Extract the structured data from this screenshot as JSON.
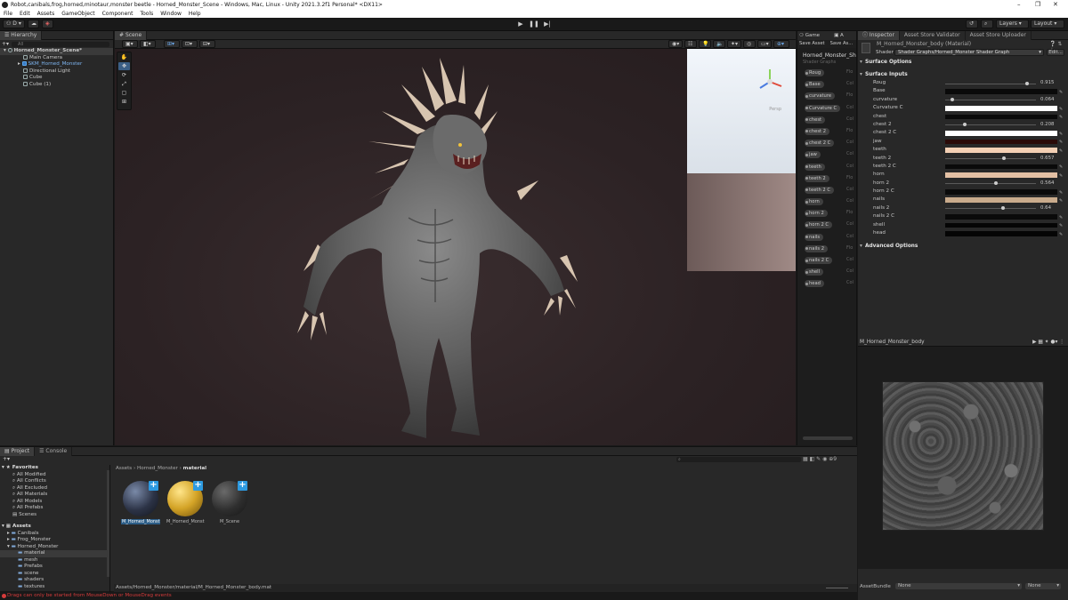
{
  "window": {
    "title": "Robot,canibals,frog,horned,minotaur,monster beetle - Horned_Monster_Scene - Windows, Mac, Linux - Unity 2021.3.2f1 Personal* <DX11>"
  },
  "menu": [
    "File",
    "Edit",
    "Assets",
    "GameObject",
    "Component",
    "Tools",
    "Window",
    "Help"
  ],
  "toolbar": {
    "account": "D",
    "layers": "Layers",
    "layout": "Layout"
  },
  "hierarchy": {
    "tab": "Hierarchy",
    "search_placeholder": "All",
    "scene": "Horned_Monster_Scene*",
    "items": [
      {
        "label": "Main Camera",
        "indent": 1
      },
      {
        "label": "SKM_Horned_Monster",
        "indent": 1,
        "prefab": true
      },
      {
        "label": "Directional Light",
        "indent": 1
      },
      {
        "label": "Cube",
        "indent": 1
      },
      {
        "label": "Cube (1)",
        "indent": 1
      }
    ]
  },
  "scene": {
    "tab": "Scene",
    "persp": "Persp"
  },
  "shadergraph": {
    "tabs": [
      "Game",
      "A"
    ],
    "save": "Save Asset",
    "save_as": "Save As...",
    "title": "Horned_Monster_Sh",
    "subtitle": "Shader Graphs",
    "properties": [
      {
        "name": "Roug",
        "type": "Flo"
      },
      {
        "name": "Base",
        "type": "Col"
      },
      {
        "name": "curvature",
        "type": "Flo"
      },
      {
        "name": "Curvature C",
        "type": "Col"
      },
      {
        "name": "chest",
        "type": "Col"
      },
      {
        "name": "chest 2",
        "type": "Flo"
      },
      {
        "name": "chest 2 C",
        "type": "Col"
      },
      {
        "name": "jaw",
        "type": "Col"
      },
      {
        "name": "teeth",
        "type": "Col"
      },
      {
        "name": "teeth 2",
        "type": "Flo"
      },
      {
        "name": "teeth 2 C",
        "type": "Col"
      },
      {
        "name": "horn",
        "type": "Col"
      },
      {
        "name": "horn 2",
        "type": "Flo"
      },
      {
        "name": "horn 2 C",
        "type": "Col"
      },
      {
        "name": "nails",
        "type": "Col"
      },
      {
        "name": "nails 2",
        "type": "Flo"
      },
      {
        "name": "nails 2 C",
        "type": "Col"
      },
      {
        "name": "shell",
        "type": "Col"
      },
      {
        "name": "head",
        "type": "Col"
      }
    ]
  },
  "inspector": {
    "tabs": [
      "Inspector",
      "Asset Store Validator",
      "Asset Store Uploader"
    ],
    "material_name": "M_Horned_Monster_body (Material)",
    "shader_label": "Shader",
    "shader_value": "Shader Graphs/Horned_Monster Shader Graph",
    "edit": "Edit...",
    "surface_options": "Surface Options",
    "surface_inputs": "Surface Inputs",
    "advanced_options": "Advanced Options",
    "rows": [
      {
        "label": "Roug",
        "kind": "slider",
        "value": "0.915",
        "fraction": 0.915
      },
      {
        "label": "Base",
        "kind": "color",
        "color": "#0a0a0a"
      },
      {
        "label": "curvature",
        "kind": "slider",
        "value": "0.064",
        "fraction": 0.064
      },
      {
        "label": "Curvature C",
        "kind": "color",
        "color": "#ffffff"
      },
      {
        "label": "chest",
        "kind": "color",
        "color": "#0a0a0a"
      },
      {
        "label": "chest 2",
        "kind": "slider",
        "value": "0.208",
        "fraction": 0.208
      },
      {
        "label": "chest 2 C",
        "kind": "color",
        "color": "#ffffff"
      },
      {
        "label": "jaw",
        "kind": "color",
        "color": "#2a0a08"
      },
      {
        "label": "teeth",
        "kind": "color",
        "color": "#f3cfb4"
      },
      {
        "label": "teeth 2",
        "kind": "slider",
        "value": "0.657",
        "fraction": 0.657
      },
      {
        "label": "teeth 2 C",
        "kind": "color",
        "color": "#0a0a0a"
      },
      {
        "label": "horn",
        "kind": "color",
        "color": "#e3c0a4"
      },
      {
        "label": "horn 2",
        "kind": "slider",
        "value": "0.564",
        "fraction": 0.564
      },
      {
        "label": "horn 2 C",
        "kind": "color",
        "color": "#0a0a0a"
      },
      {
        "label": "nails",
        "kind": "color",
        "color": "#c9ab8c"
      },
      {
        "label": "nails 2",
        "kind": "slider",
        "value": "0.64",
        "fraction": 0.64
      },
      {
        "label": "nails 2 C",
        "kind": "color",
        "color": "#0a0a0a"
      },
      {
        "label": "shell",
        "kind": "color",
        "color": "#050505"
      },
      {
        "label": "head",
        "kind": "color",
        "color": "#050505"
      }
    ],
    "preview_title": "M_Horned_Monster_body",
    "assetbundle_label": "AssetBundle",
    "assetbundle_value": "None",
    "assetbundle_variant": "None"
  },
  "project": {
    "tabs": [
      "Project",
      "Console"
    ],
    "favorites_label": "Favorites",
    "favorites": [
      "All Modified",
      "All Conflicts",
      "All Excluded",
      "All Materials",
      "All Models",
      "All Prefabs",
      "Scenes"
    ],
    "assets_label": "Assets",
    "tree": [
      {
        "label": "Canibals",
        "indent": 1
      },
      {
        "label": "Frog_Monster",
        "indent": 1
      },
      {
        "label": "Horned_Monster",
        "indent": 1
      },
      {
        "label": "material",
        "indent": 2,
        "selected": true
      },
      {
        "label": "mesh",
        "indent": 2
      },
      {
        "label": "Prefabs",
        "indent": 2
      },
      {
        "label": "scene",
        "indent": 2
      },
      {
        "label": "shaders",
        "indent": 2
      },
      {
        "label": "textures",
        "indent": 2
      }
    ],
    "breadcrumb": [
      "Assets",
      "Horned_Monster",
      "material"
    ],
    "assets": [
      {
        "label": "M_Horned_Monst...",
        "selected": true
      },
      {
        "label": "M_Horned_Monst..."
      },
      {
        "label": "M_Scene"
      }
    ],
    "path": "Assets/Horned_Monster/material/M_Horned_Monster_body.mat"
  },
  "status": {
    "message": "Drags can only be started from MouseDown or MouseDrag events"
  }
}
